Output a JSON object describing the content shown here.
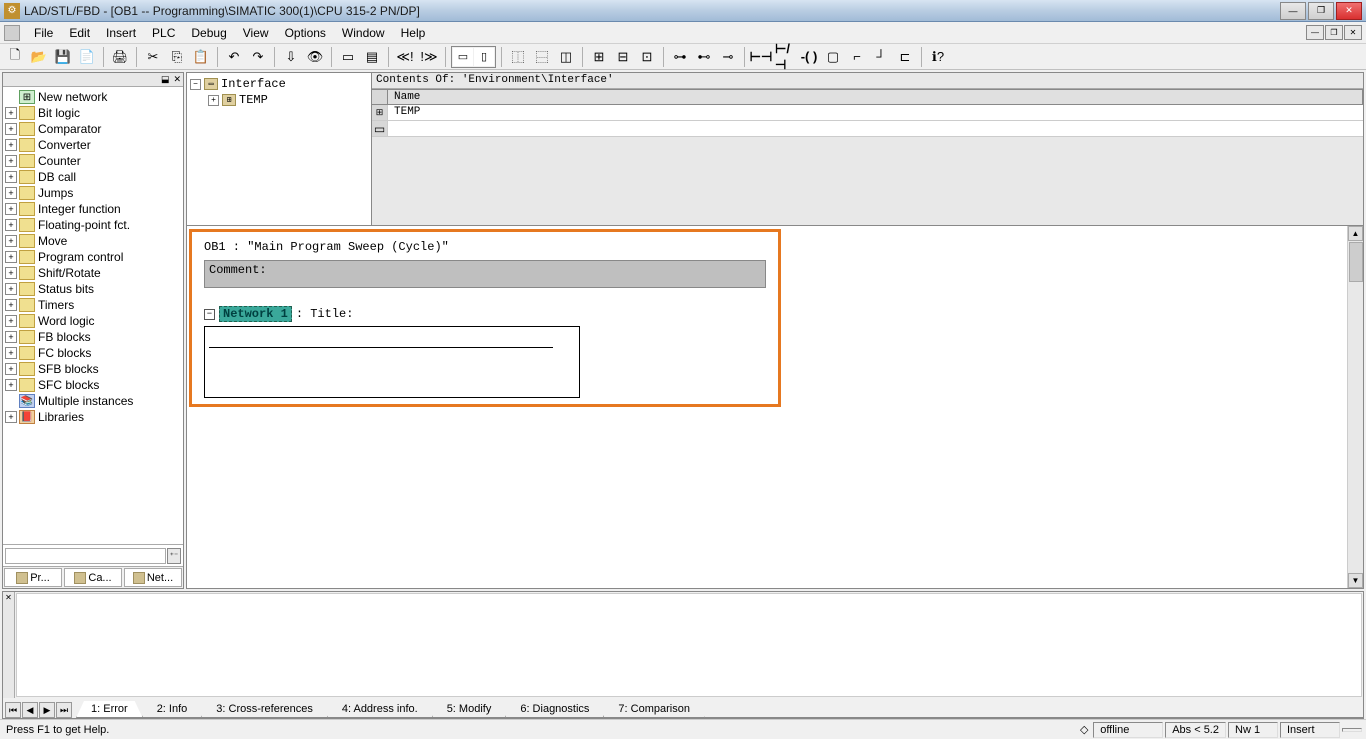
{
  "title": "LAD/STL/FBD  - [OB1 -- Programming\\SIMATIC 300(1)\\CPU 315-2 PN/DP]",
  "menu": [
    "File",
    "Edit",
    "Insert",
    "PLC",
    "Debug",
    "View",
    "Options",
    "Window",
    "Help"
  ],
  "sidebar": {
    "items": [
      {
        "label": "New network",
        "icon": "net"
      },
      {
        "label": "Bit logic",
        "icon": "fld"
      },
      {
        "label": "Comparator",
        "icon": "fld"
      },
      {
        "label": "Converter",
        "icon": "fld"
      },
      {
        "label": "Counter",
        "icon": "fld"
      },
      {
        "label": "DB call",
        "icon": "fld"
      },
      {
        "label": "Jumps",
        "icon": "fld"
      },
      {
        "label": "Integer function",
        "icon": "fld"
      },
      {
        "label": "Floating-point fct.",
        "icon": "fld"
      },
      {
        "label": "Move",
        "icon": "fld"
      },
      {
        "label": "Program control",
        "icon": "fld"
      },
      {
        "label": "Shift/Rotate",
        "icon": "fld"
      },
      {
        "label": "Status bits",
        "icon": "fld"
      },
      {
        "label": "Timers",
        "icon": "fld"
      },
      {
        "label": "Word logic",
        "icon": "fld"
      },
      {
        "label": "FB blocks",
        "icon": "fld"
      },
      {
        "label": "FC blocks",
        "icon": "fld"
      },
      {
        "label": "SFB blocks",
        "icon": "fld"
      },
      {
        "label": "SFC blocks",
        "icon": "fld"
      },
      {
        "label": "Multiple instances",
        "icon": "multi"
      },
      {
        "label": "Libraries",
        "icon": "lib"
      }
    ],
    "tabs": [
      "Pr...",
      "Ca...",
      "Net..."
    ]
  },
  "interface": {
    "root": "Interface",
    "child": "TEMP"
  },
  "contents": {
    "header": "Contents Of: 'Environment\\Interface'",
    "column": "Name",
    "row1": "TEMP"
  },
  "editor": {
    "ob_line": "OB1 :  \"Main Program Sweep (Cycle)\"",
    "comment_label": "Comment:",
    "network_label": "Network 1",
    "title_suffix": ": Title:"
  },
  "bottom_tabs": [
    "1: Error",
    "2: Info",
    "3: Cross-references",
    "4: Address info.",
    "5: Modify",
    "6: Diagnostics",
    "7: Comparison"
  ],
  "status": {
    "help": "Press F1 to get Help.",
    "offline": "offline",
    "abs": "Abs < 5.2",
    "nw": "Nw 1",
    "insert": "Insert"
  }
}
